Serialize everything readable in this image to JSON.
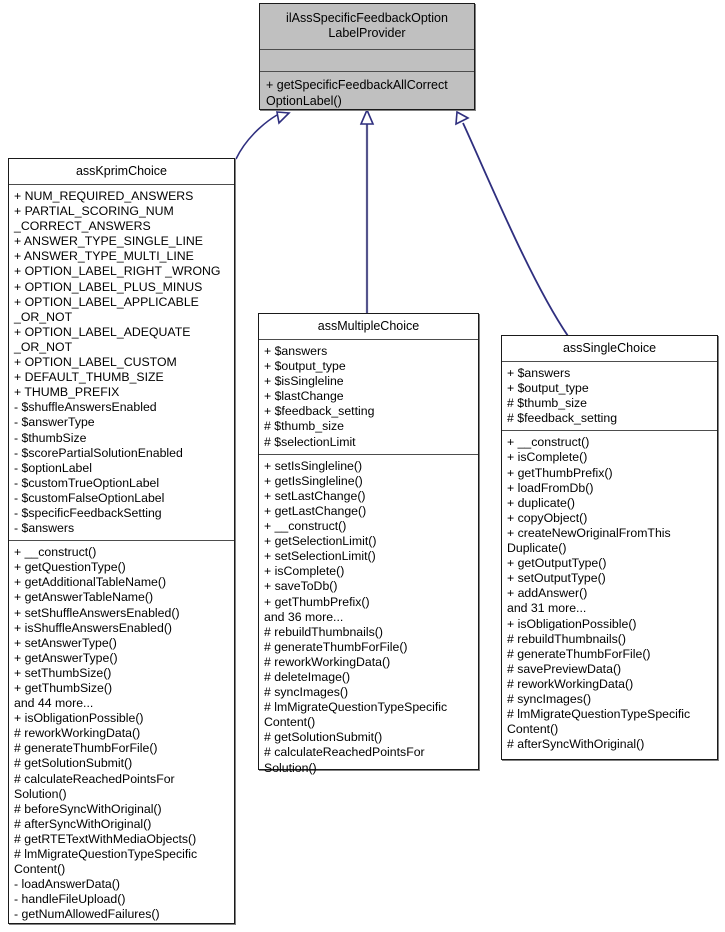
{
  "diagram": {
    "type": "uml-class-diagram",
    "edge_color": "#2f2f7f",
    "interface_fill": "#c0c0c0",
    "class_fill": "#ffffff",
    "border_color": "#1a1a1a"
  },
  "classes": {
    "interface": {
      "name": "ilAssSpecificFeedbackOption\nLabelProvider",
      "name_line1": "ilAssSpecificFeedbackOption",
      "name_line2": "LabelProvider",
      "stereotype": "interface",
      "attributes": [],
      "methods": [
        "+ getSpecificFeedbackAllCorrect OptionLabel()"
      ]
    },
    "kprim": {
      "name": "assKprimChoice",
      "attributes": [
        "+ NUM_REQUIRED_ANSWERS",
        "+ PARTIAL_SCORING_NUM _CORRECT_ANSWERS",
        "+ ANSWER_TYPE_SINGLE_LINE",
        "+ ANSWER_TYPE_MULTI_LINE",
        "+ OPTION_LABEL_RIGHT _WRONG",
        "+ OPTION_LABEL_PLUS_MINUS",
        "+ OPTION_LABEL_APPLICABLE _OR_NOT",
        "+ OPTION_LABEL_ADEQUATE _OR_NOT",
        "+ OPTION_LABEL_CUSTOM",
        "+ DEFAULT_THUMB_SIZE",
        "+ THUMB_PREFIX",
        "- $shuffleAnswersEnabled",
        "- $answerType",
        "- $thumbSize",
        "- $scorePartialSolutionEnabled",
        "- $optionLabel",
        "- $customTrueOptionLabel",
        "- $customFalseOptionLabel",
        "- $specificFeedbackSetting",
        "- $answers"
      ],
      "methods": [
        "+ __construct()",
        "+ getQuestionType()",
        "+ getAdditionalTableName()",
        "+ getAnswerTableName()",
        "+ setShuffleAnswersEnabled()",
        "+ isShuffleAnswersEnabled()",
        "+ setAnswerType()",
        "+ getAnswerType()",
        "+ setThumbSize()",
        "+ getThumbSize()",
        "and 44 more...",
        "+ isObligationPossible()",
        "# reworkWorkingData()",
        "# generateThumbForFile()",
        "# getSolutionSubmit()",
        "# calculateReachedPointsFor Solution()",
        "# beforeSyncWithOriginal()",
        "# afterSyncWithOriginal()",
        "# getRTETextWithMediaObjects()",
        "# lmMigrateQuestionTypeSpecific Content()",
        "- loadAnswerData()",
        "- handleFileUpload()",
        "- getNumAllowedFailures()"
      ]
    },
    "multiple": {
      "name": "assMultipleChoice",
      "attributes": [
        "+ $answers",
        "+ $output_type",
        "+ $isSingleline",
        "+ $lastChange",
        "+ $feedback_setting",
        "# $thumb_size",
        "# $selectionLimit"
      ],
      "methods": [
        "+ setIsSingleline()",
        "+ getIsSingleline()",
        "+ setLastChange()",
        "+ getLastChange()",
        "+ __construct()",
        "+ getSelectionLimit()",
        "+ setSelectionLimit()",
        "+ isComplete()",
        "+ saveToDb()",
        "+ getThumbPrefix()",
        "and 36 more...",
        "# rebuildThumbnails()",
        "# generateThumbForFile()",
        "# reworkWorkingData()",
        "# deleteImage()",
        "# syncImages()",
        "# lmMigrateQuestionTypeSpecific Content()",
        "# getSolutionSubmit()",
        "# calculateReachedPointsFor Solution()"
      ]
    },
    "single": {
      "name": "assSingleChoice",
      "attributes": [
        "+ $answers",
        "+ $output_type",
        "# $thumb_size",
        "# $feedback_setting"
      ],
      "methods": [
        "+ __construct()",
        "+ isComplete()",
        "+ getThumbPrefix()",
        "+ loadFromDb()",
        "+ duplicate()",
        "+ copyObject()",
        "+ createNewOriginalFromThis Duplicate()",
        "+ getOutputType()",
        "+ setOutputType()",
        "+ addAnswer()",
        "and 31 more...",
        "+ isObligationPossible()",
        "# rebuildThumbnails()",
        "# generateThumbForFile()",
        "# savePreviewData()",
        "# reworkWorkingData()",
        "# syncImages()",
        "# lmMigrateQuestionTypeSpecific Content()",
        "# afterSyncWithOriginal()"
      ]
    }
  },
  "relations": [
    {
      "from": "assKprimChoice",
      "to": "ilAssSpecificFeedbackOptionLabelProvider",
      "kind": "realization"
    },
    {
      "from": "assMultipleChoice",
      "to": "ilAssSpecificFeedbackOptionLabelProvider",
      "kind": "realization"
    },
    {
      "from": "assSingleChoice",
      "to": "ilAssSpecificFeedbackOptionLabelProvider",
      "kind": "realization"
    }
  ]
}
